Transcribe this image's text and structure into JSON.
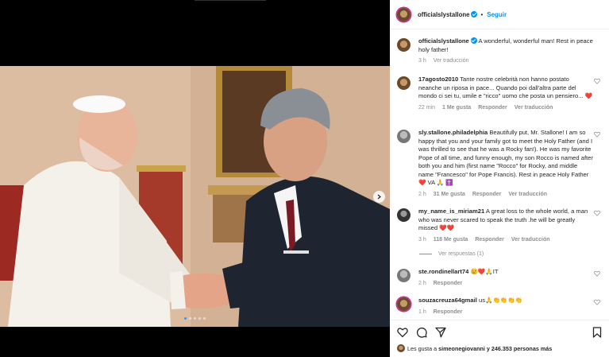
{
  "post": {
    "username": "officialslystallone",
    "follow_label": "Seguir",
    "caption": "A wonderful, wonderful man! Rest in peace holy father!",
    "caption_time": "3 h",
    "caption_translate": "Ver traducción"
  },
  "comments": [
    {
      "username": "17agosto2010",
      "text": "Tante nostre celebrità non hanno postato neanche un riposa in pace... Quando poi dall'altra parte del mondo ci sei tu, umile e \"ricco\" uomo che posta un pensiero... ❤️",
      "time": "22 min",
      "likes": "1 Me gusta",
      "reply": "Responder",
      "translate": "Ver traducción"
    },
    {
      "username": "sly.stallone.philadelphia",
      "text": "Beautifully put, Mr. Stallone! I am so happy that you and your family got to meet the Holy Father (and I was thrilled to see that he was a Rocky fan!). He was my favorite Pope of all time, and funny enough, my son Rocco is named after both you and him (first name \"Rocco\" for Rocky, and middle name \"Francesco\" for Pope Francis). Rest in peace Holy Father ❤️ VA 🙏 ✝️",
      "time": "2 h",
      "likes": "31 Me gusta",
      "reply": "Responder",
      "translate": "Ver traducción"
    },
    {
      "username": "my_name_is_miriam21",
      "text": "A great loss to the whole world, a man who was never scared to speak the truth .he will be greatly missed ❤️❤️",
      "time": "3 h",
      "likes": "118 Me gusta",
      "reply": "Responder",
      "translate": "Ver traducción"
    },
    {
      "username": "ste.rondinellart74",
      "text": "😢❤️🙏IT",
      "time": "2 h",
      "reply": "Responder"
    },
    {
      "username": "souzacreuza64gmail",
      "text": "us🙏👏👏👏👏",
      "time": "1 h",
      "reply": "Responder"
    }
  ],
  "view_replies": "Ver respuestas (1)",
  "likes_line": {
    "prefix": "Les gusta a",
    "user": "simeonegiovanni",
    "suffix": "y 246.353 personas más"
  },
  "colors": {
    "accent": "#0095f6",
    "heart_red": "#ed4956"
  },
  "carousel": {
    "slides": 5,
    "active": 1
  }
}
